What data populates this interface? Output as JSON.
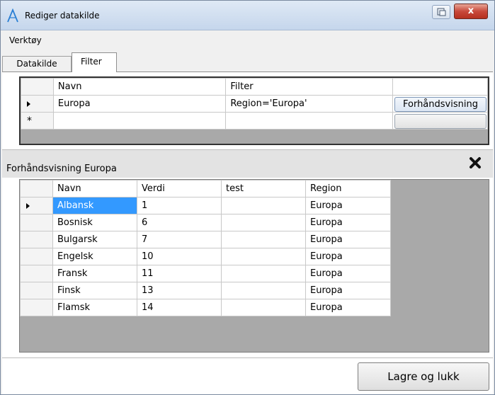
{
  "window": {
    "title": "Rediger datakilde",
    "close_label": "x"
  },
  "menu": {
    "items": [
      "Verktøy"
    ]
  },
  "tabs": [
    {
      "label": "Datakilde",
      "selected": false
    },
    {
      "label": "Filter",
      "selected": true
    }
  ],
  "filter_grid": {
    "columns": [
      "Navn",
      "Filter",
      ""
    ],
    "rows": [
      {
        "name": "Europa",
        "filter": "Region='Europa'",
        "button_label": "Forhåndsvisning"
      }
    ],
    "new_row_marker": "*"
  },
  "preview": {
    "title": "Forhåndsvisning Europa",
    "columns": [
      "Navn",
      "Verdi",
      "test",
      "Region"
    ],
    "rows": [
      {
        "navn": "Albansk",
        "verdi": "1",
        "test": "",
        "region": "Europa",
        "selected": true
      },
      {
        "navn": "Bosnisk",
        "verdi": "6",
        "test": "",
        "region": "Europa"
      },
      {
        "navn": "Bulgarsk",
        "verdi": "7",
        "test": "",
        "region": "Europa"
      },
      {
        "navn": "Engelsk",
        "verdi": "10",
        "test": "",
        "region": "Europa"
      },
      {
        "navn": "Fransk",
        "verdi": "11",
        "test": "",
        "region": "Europa"
      },
      {
        "navn": "Finsk",
        "verdi": "13",
        "test": "",
        "region": "Europa"
      },
      {
        "navn": "Flamsk",
        "verdi": "14",
        "test": "",
        "region": "Europa"
      }
    ]
  },
  "footer": {
    "save_label": "Lagre og lukk"
  },
  "colors": {
    "selection": "#3399ff",
    "selection_text": "#ffffff",
    "grid_background": "#a9a9a9"
  }
}
